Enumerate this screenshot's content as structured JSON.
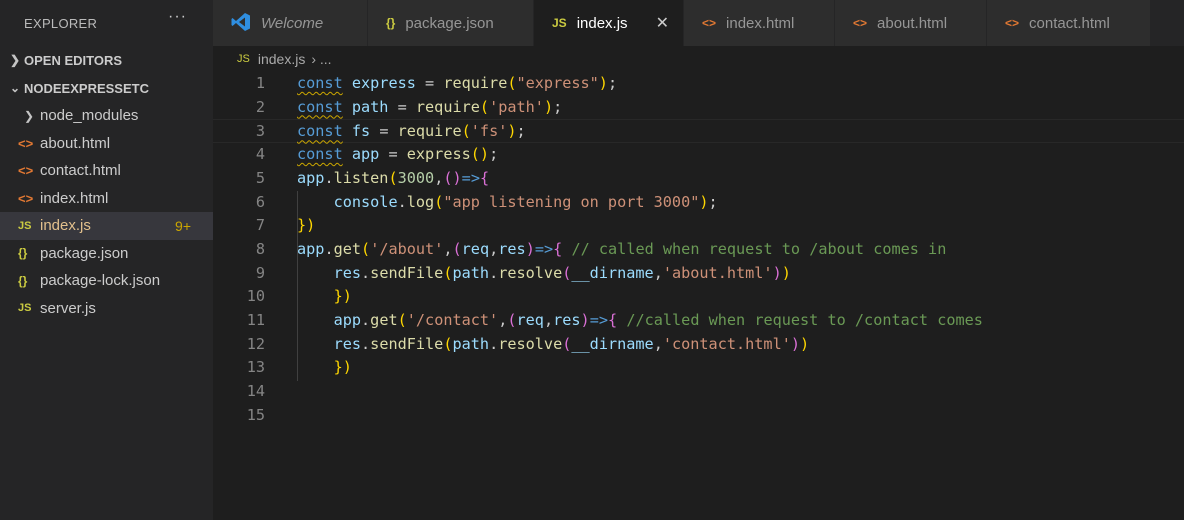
{
  "explorer": {
    "title": "EXPLORER",
    "more": "···",
    "open_editors": "OPEN EDITORS",
    "project": "NODEEXPRESSETC",
    "items": [
      {
        "label": "node_modules",
        "icon": "chevron-right-icon"
      },
      {
        "label": "about.html",
        "icon": "html-icon"
      },
      {
        "label": "contact.html",
        "icon": "html-icon"
      },
      {
        "label": "index.html",
        "icon": "html-icon"
      },
      {
        "label": "index.js",
        "icon": "js-icon",
        "badge": "9+"
      },
      {
        "label": "package.json",
        "icon": "json-icon"
      },
      {
        "label": "package-lock.json",
        "icon": "json-icon"
      },
      {
        "label": "server.js",
        "icon": "js-icon"
      }
    ]
  },
  "icons": {
    "js": "JS",
    "json": "{}",
    "html": "<>",
    "close": "✕",
    "vscode": "vscode-icon"
  },
  "tabs": [
    {
      "label": "Welcome",
      "icon": "vscode-icon"
    },
    {
      "label": "package.json",
      "icon": "json-icon"
    },
    {
      "label": "index.js",
      "icon": "js-icon",
      "active": true
    },
    {
      "label": "index.html",
      "icon": "html-icon"
    },
    {
      "label": "about.html",
      "icon": "html-icon"
    },
    {
      "label": "contact.html",
      "icon": "html-icon"
    }
  ],
  "breadcrumb": {
    "file": "index.js",
    "rest": "›  ..."
  },
  "editor": {
    "lines": [
      "const express = require(\"express\");",
      "const path = require('path');",
      "const fs = require('fs');",
      "const app = express();",
      "app.listen(3000,()=>{",
      "    console.log(\"app listening on port 3000\");",
      "})",
      "app.get('/about',(req,res)=>{ // called when request to /about comes in",
      "    res.sendFile(path.resolve(__dirname,'about.html'))",
      "    })",
      "    app.get('/contact',(req,res)=>{ //called when request to /contact comes",
      "    res.sendFile(path.resolve(__dirname,'contact.html'))",
      "    })",
      "",
      ""
    ],
    "line_numbers": [
      "1",
      "2",
      "3",
      "4",
      "5",
      "6",
      "7",
      "8",
      "9",
      "10",
      "11",
      "12",
      "13",
      "14",
      "15"
    ]
  },
  "colors": {
    "background": "#1e1e1e",
    "sidebar": "#252526",
    "keyword": "#569cd6",
    "string": "#ce9178",
    "comment": "#6a9955",
    "badge": "#cca700"
  }
}
